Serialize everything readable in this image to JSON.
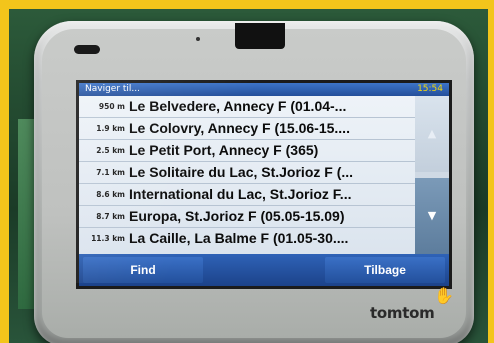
{
  "device": {
    "brand": "tomtom"
  },
  "titlebar": {
    "title": "Naviger til...",
    "clock": "15:54"
  },
  "list": {
    "rows": [
      {
        "distance": "950 m",
        "name": "Le Belvedere, Annecy F (01.04-..."
      },
      {
        "distance": "1.9 km",
        "name": "Le Colovry, Annecy F (15.06-15...."
      },
      {
        "distance": "2.5 km",
        "name": "Le Petit Port, Annecy F (365)"
      },
      {
        "distance": "7.1 km",
        "name": "Le Solitaire du Lac, St.Jorioz F (..."
      },
      {
        "distance": "8.6 km",
        "name": "International du Lac, St.Jorioz F..."
      },
      {
        "distance": "8.7 km",
        "name": "Europa, St.Jorioz F (05.05-15.09)"
      },
      {
        "distance": "11.3 km",
        "name": "La Caille, La Balme F (01.05-30...."
      }
    ]
  },
  "scroll": {
    "up_icon": "triangle-up-icon",
    "down_icon": "triangle-down-icon"
  },
  "bottombar": {
    "find_label": "Find",
    "back_label": "Tilbage"
  },
  "colors": {
    "frame": "#f3c51b",
    "titlebar": "#2f63b7",
    "clock": "#f5d90a",
    "list_bg": "#e6edf4"
  }
}
